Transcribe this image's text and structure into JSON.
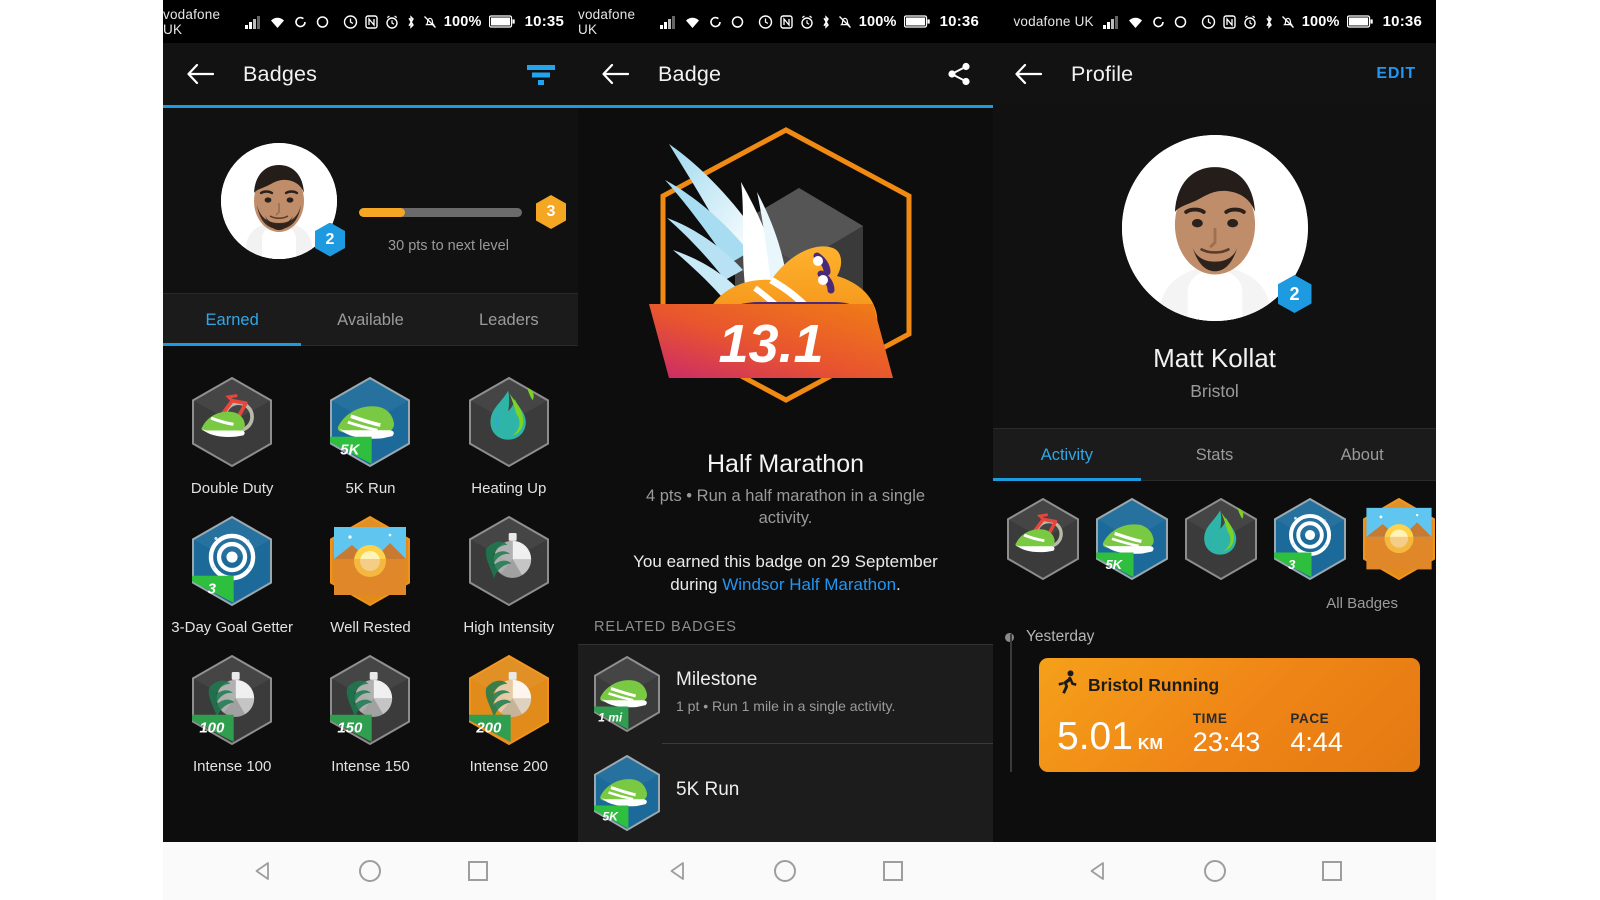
{
  "status_bar": {
    "carrier": "vodafone UK",
    "battery": "100%",
    "time_left": "10:35",
    "time_center": "10:36",
    "time_right": "10:36",
    "icons": [
      "signal-icon",
      "wifi-icon",
      "sync-icon",
      "circle-icon",
      "do-not-disturb-icon",
      "nfc-icon",
      "alarm-icon",
      "bluetooth-icon",
      "mute-icon",
      "battery-icon"
    ]
  },
  "accent_colors": {
    "blue": "#1e9ae0",
    "orange": "#f5a623",
    "link": "#2196f3"
  },
  "badges_screen": {
    "title": "Badges",
    "filter_icon": "filter-icon",
    "back_icon": "back-arrow-icon",
    "level_current": "2",
    "level_next": "3",
    "progress_caption": "30 pts to next level",
    "progress_percent": 28,
    "tabs": [
      {
        "label": "Earned",
        "active": true
      },
      {
        "label": "Available",
        "active": false
      },
      {
        "label": "Leaders",
        "active": false
      }
    ],
    "badges": [
      {
        "label": "Double Duty",
        "art": "bike-shoe",
        "ribbon": "",
        "frame": "grey"
      },
      {
        "label": "5K Run",
        "art": "shoe",
        "ribbon": "5K",
        "frame": "blue"
      },
      {
        "label": "Heating Up",
        "art": "flame",
        "ribbon": "",
        "frame": "grey"
      },
      {
        "label": "3-Day Goal Getter",
        "art": "target",
        "ribbon": "3",
        "frame": "blue"
      },
      {
        "label": "Well Rested",
        "art": "sunrise",
        "ribbon": "",
        "frame": "orange"
      },
      {
        "label": "High Intensity",
        "art": "stopwatch",
        "ribbon": "",
        "frame": "grey"
      },
      {
        "label": "Intense 100",
        "art": "stopwatch",
        "ribbon": "100",
        "frame": "grey"
      },
      {
        "label": "Intense 150",
        "art": "stopwatch",
        "ribbon": "150",
        "frame": "grey"
      },
      {
        "label": "Intense 200",
        "art": "stopwatch",
        "ribbon": "200",
        "frame": "orange"
      }
    ]
  },
  "badge_detail_screen": {
    "title": "Badge",
    "share_icon": "share-icon",
    "back_icon": "back-arrow-icon",
    "hero_label": "13.1",
    "badge_name": "Half Marathon",
    "badge_points_desc": "4 pts • Run a half marathon in a single activity.",
    "earned_prefix": "You earned this badge on 29 September during ",
    "earned_link": "Windsor Half Marathon",
    "earned_suffix": ".",
    "related_header": "RELATED BADGES",
    "related": [
      {
        "name": "Milestone",
        "desc": "1 pt • Run 1 mile in a single activity.",
        "ribbon": "1 mi",
        "frame": "grey"
      },
      {
        "name": "5K Run",
        "desc": "",
        "ribbon": "5K",
        "frame": "blue"
      }
    ]
  },
  "profile_screen": {
    "title": "Profile",
    "edit_label": "EDIT",
    "back_icon": "back-arrow-icon",
    "user_name": "Matt Kollat",
    "user_city": "Bristol",
    "user_level": "2",
    "tabs": [
      {
        "label": "Activity",
        "active": true
      },
      {
        "label": "Stats",
        "active": false
      },
      {
        "label": "About",
        "active": false
      }
    ],
    "badge_strip": [
      {
        "art": "bike-shoe",
        "ribbon": "",
        "frame": "grey"
      },
      {
        "art": "shoe",
        "ribbon": "5K",
        "frame": "blue"
      },
      {
        "art": "flame",
        "ribbon": "",
        "frame": "grey"
      },
      {
        "art": "target",
        "ribbon": "3",
        "frame": "blue"
      },
      {
        "art": "sunrise",
        "ribbon": "",
        "frame": "orange"
      }
    ],
    "all_badges_label": "All Badges",
    "timeline_day": "Yesterday",
    "activity": {
      "icon": "running-icon",
      "title": "Bristol Running",
      "distance": "5.01",
      "distance_unit": "KM",
      "time_label": "TIME",
      "time_value": "23:43",
      "pace_label": "PACE",
      "pace_value": "4:44"
    }
  },
  "nav_bar": {
    "back_icon": "nav-back-triangle-icon",
    "home_icon": "nav-home-circle-icon",
    "recents_icon": "nav-recents-square-icon"
  }
}
